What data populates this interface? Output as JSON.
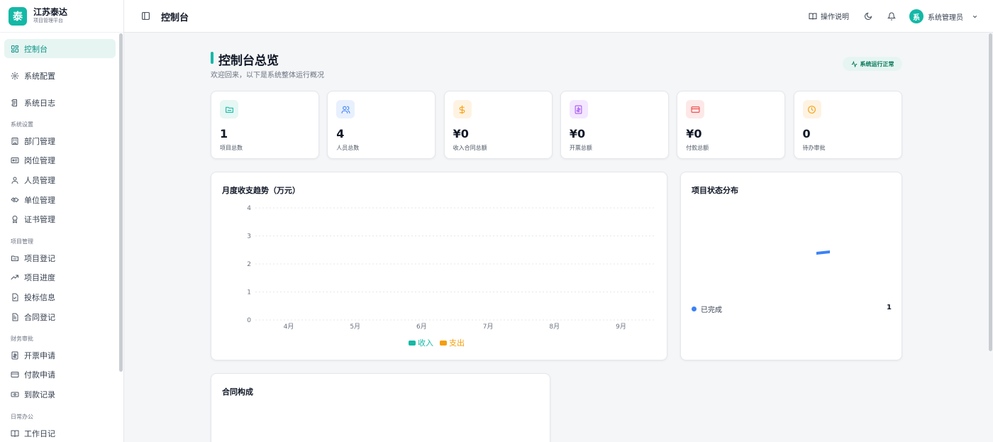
{
  "brand": {
    "logo_char": "泰",
    "title": "江苏泰达",
    "subtitle": "项目管理平台"
  },
  "colors": {
    "accent": "#14b8a6",
    "income": "#14b8a6",
    "expense": "#f59e0b",
    "done": "#3b82f6"
  },
  "sidebar": {
    "top": [
      {
        "label": "控制台",
        "icon": "dashboard-icon",
        "active": true
      },
      {
        "label": "系统配置",
        "icon": "gear-icon"
      },
      {
        "label": "系统日志",
        "icon": "log-icon"
      }
    ],
    "sections": [
      {
        "title": "系统设置",
        "items": [
          {
            "label": "部门管理",
            "icon": "building-icon"
          },
          {
            "label": "岗位管理",
            "icon": "id-card-icon"
          },
          {
            "label": "人员管理",
            "icon": "user-icon"
          },
          {
            "label": "单位管理",
            "icon": "handshake-icon"
          },
          {
            "label": "证书管理",
            "icon": "award-icon"
          }
        ]
      },
      {
        "title": "项目管理",
        "items": [
          {
            "label": "项目登记",
            "icon": "folder-icon"
          },
          {
            "label": "项目进度",
            "icon": "trend-icon"
          },
          {
            "label": "投标信息",
            "icon": "file-check-icon"
          },
          {
            "label": "合同登记",
            "icon": "file-text-icon"
          }
        ]
      },
      {
        "title": "财务审批",
        "items": [
          {
            "label": "开票申请",
            "icon": "receipt-icon"
          },
          {
            "label": "付款申请",
            "icon": "credit-card-icon"
          },
          {
            "label": "到款记录",
            "icon": "banknote-icon"
          }
        ]
      },
      {
        "title": "日常办公",
        "items": [
          {
            "label": "工作日记",
            "icon": "book-icon"
          }
        ]
      }
    ]
  },
  "topbar": {
    "title": "控制台",
    "help": "操作说明",
    "user_initial": "系",
    "user_name": "系统管理员"
  },
  "header": {
    "title": "控制台总览",
    "subtitle": "欢迎回来，以下是系统整体运行概况",
    "status": "系统运行正常"
  },
  "stats": [
    {
      "value": "1",
      "label": "项目总数",
      "icon": "folder-icon",
      "color": "#14b8a6",
      "bg": "#e6f7f4"
    },
    {
      "value": "4",
      "label": "人员总数",
      "icon": "users-icon",
      "color": "#3b82f6",
      "bg": "#e8f0fe"
    },
    {
      "value": "¥0",
      "label": "收入合同总额",
      "icon": "dollar-icon",
      "color": "#f59e0b",
      "bg": "#fef3e2"
    },
    {
      "value": "¥0",
      "label": "开票总额",
      "icon": "receipt-icon",
      "color": "#a855f7",
      "bg": "#f3e8ff"
    },
    {
      "value": "¥0",
      "label": "付款总额",
      "icon": "credit-card-icon",
      "color": "#ef4444",
      "bg": "#fde8e8"
    },
    {
      "value": "0",
      "label": "待办审批",
      "icon": "clock-icon",
      "color": "#f59e0b",
      "bg": "#fef3e2"
    }
  ],
  "trend_title": "月度收支趋势（万元）",
  "status_title": "项目状态分布",
  "contract_title": "合同构成",
  "chart_data": [
    {
      "type": "bar",
      "title": "月度收支趋势（万元）",
      "categories": [
        "4月",
        "5月",
        "6月",
        "7月",
        "8月",
        "9月"
      ],
      "series": [
        {
          "name": "收入",
          "values": [
            0,
            0,
            0,
            0,
            0,
            0
          ]
        },
        {
          "name": "支出",
          "values": [
            0,
            0,
            0,
            0,
            0,
            0
          ]
        }
      ],
      "yticks": [
        "0",
        "1",
        "2",
        "3",
        "4"
      ],
      "ylim": [
        0,
        4
      ],
      "grid": true,
      "legend": "bottom"
    },
    {
      "type": "pie",
      "title": "项目状态分布",
      "slices": [
        {
          "label": "已完成",
          "value": 1
        }
      ],
      "legend": "bottom"
    }
  ]
}
